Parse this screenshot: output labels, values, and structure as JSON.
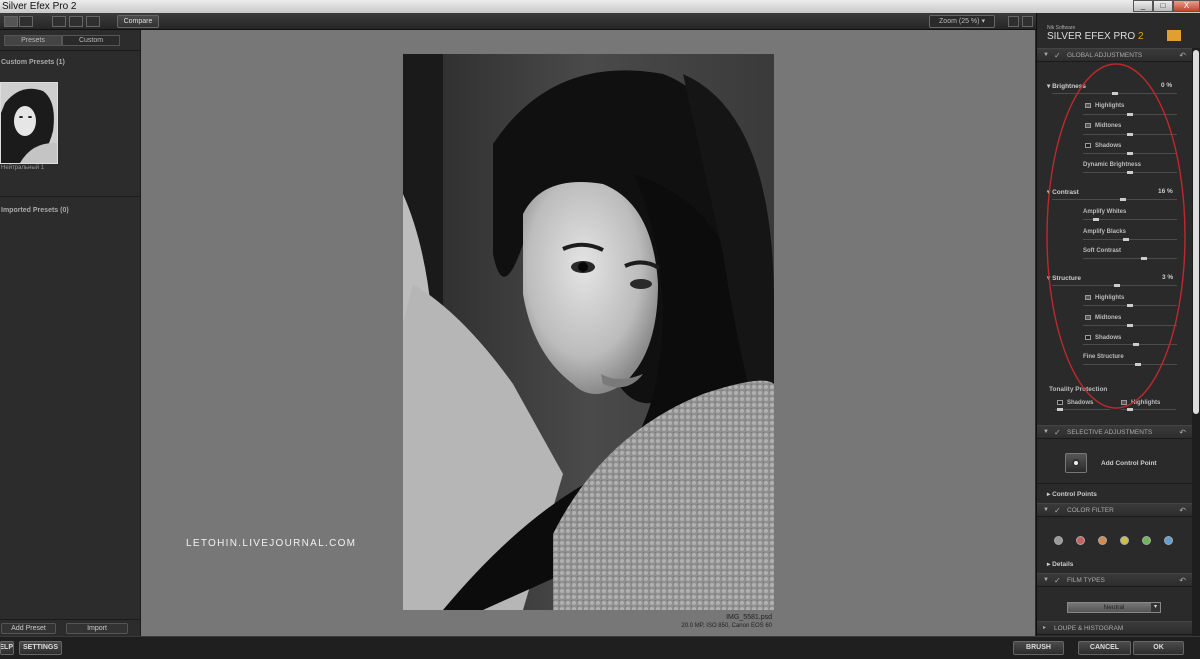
{
  "window": {
    "title": "Silver Efex Pro 2",
    "min": "_",
    "max": "□",
    "close": "X"
  },
  "toolbar": {
    "compare": "Compare",
    "zoom": "Zoom (25 %)"
  },
  "left": {
    "tabs": [
      "Presets",
      "Custom"
    ],
    "custom_title": "Custom Presets (1)",
    "preset_name": "Нейтральный 1",
    "imported_title": "Imported Presets (0)",
    "add_preset": "Add Preset",
    "import": "Import"
  },
  "center": {
    "watermark": "LETOHIN.LIVEJOURNAL.COM",
    "filename": "IMG_5581.psd",
    "fileinfo": "20.0 MP, ISO 850, Canon EOS 60"
  },
  "right": {
    "brand_small": "Nik Software",
    "brand": "SILVER EFEX PRO",
    "brand_num": "2",
    "global": "GLOBAL ADJUSTMENTS",
    "brightness": "Brightness",
    "brightness_val": "0 %",
    "highlights": "Highlights",
    "midtones": "Midtones",
    "shadows": "Shadows",
    "dynamic": "Dynamic Brightness",
    "contrast": "Contrast",
    "contrast_val": "16 %",
    "amp_whites": "Amplify Whites",
    "amp_blacks": "Amplify Blacks",
    "soft_contrast": "Soft Contrast",
    "structure": "Structure",
    "structure_val": "3 %",
    "fine_structure": "Fine Structure",
    "tonality": "Tonality Protection",
    "selective": "SELECTIVE ADJUSTMENTS",
    "add_cp": "Add Control Point",
    "control_points": "Control Points",
    "color_filter": "COLOR FILTER",
    "filter_colors": [
      "#9a9a9a",
      "#c96060",
      "#d58a4a",
      "#c7c04a",
      "#6fb65a",
      "#5f9ed6"
    ],
    "details": "Details",
    "film_types": "FILM TYPES",
    "film_select": "Neutral",
    "loupe": "LOUPE & HISTOGRAM"
  },
  "bottom": {
    "help": "HELP",
    "settings": "SETTINGS",
    "brush": "BRUSH",
    "cancel": "CANCEL",
    "ok": "OK"
  },
  "colors": {
    "annotation": "#c0282d",
    "accent": "#e0a030"
  }
}
